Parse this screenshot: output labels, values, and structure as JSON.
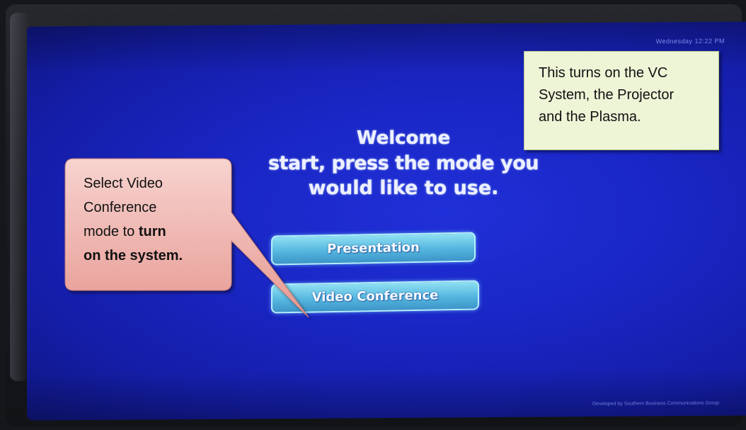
{
  "screen": {
    "clock": "Wednesday 12:22 PM",
    "welcome_title": "Welcome",
    "welcome_line2": "start, press the mode you",
    "welcome_line3": "would like to use.",
    "buttons": {
      "presentation": "Presentation",
      "video_conference": "Video Conference"
    },
    "footer": "Developed by Southern Business Communications Group"
  },
  "callouts": {
    "vc_system": {
      "line1": "This turns on the VC",
      "line2": "System, the Projector",
      "line3": "and the Plasma."
    },
    "select": {
      "line1": "Select Video",
      "line2": "Conference",
      "line3_plain": "mode to ",
      "line3_bold": "turn",
      "line4_bold": "on the system."
    }
  },
  "colors": {
    "screen_blue": "#1a26c4",
    "button_cyan": "#55b6df",
    "green_callout": "#eef4d6",
    "pink_callout": "#f2b3ae"
  }
}
